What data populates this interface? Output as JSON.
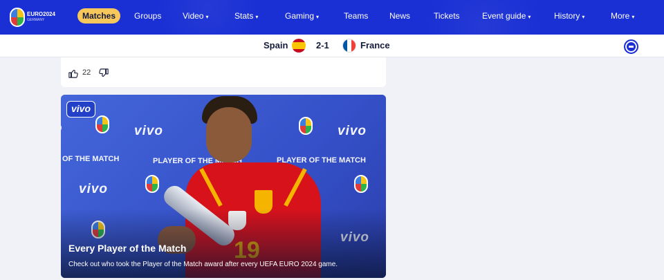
{
  "nav": {
    "logo_text": "EURO2024",
    "logo_sub": "GERMANY",
    "items": [
      {
        "label": "Matches",
        "active": true,
        "caret": ""
      },
      {
        "label": "Groups",
        "caret": ""
      },
      {
        "label": "Video",
        "caret": "▾"
      },
      {
        "label": "Stats",
        "caret": "▾"
      },
      {
        "label": "Gaming",
        "caret": "▾"
      },
      {
        "label": "Teams",
        "caret": ""
      },
      {
        "label": "News",
        "caret": ""
      },
      {
        "label": "Tickets",
        "caret": ""
      },
      {
        "label": "Event guide",
        "caret": "▾"
      },
      {
        "label": "History",
        "caret": "▾"
      },
      {
        "label": "More",
        "caret": "▾"
      }
    ]
  },
  "scorebar": {
    "home_team": "Spain",
    "away_team": "France",
    "score": "2-1"
  },
  "feedback": {
    "likes": "22"
  },
  "media_card": {
    "sponsor_box": "vivo",
    "sponsor": "vivo",
    "backdrop_text": "PLAYER OF THE MATCH",
    "backdrop_text_cut": "OF THE MATCH",
    "shirt_number": "19",
    "title": "Every Player of the Match",
    "description": "Check out who took the Player of the Match award after every UEFA EURO 2024 game."
  },
  "colors": {
    "nav_bg": "#1a2fd4",
    "active_pill": "#f6c75a",
    "page_bg": "#f0f2f7"
  }
}
